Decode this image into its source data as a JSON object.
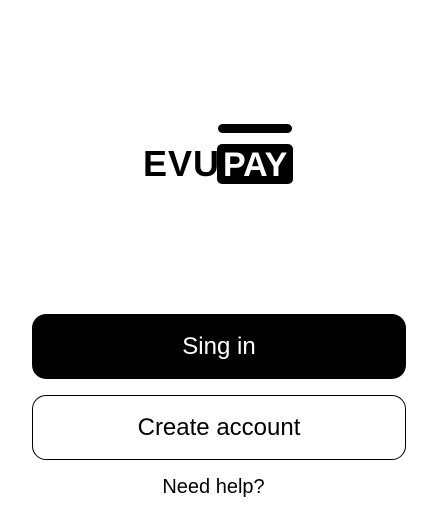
{
  "logo": {
    "name": "EVUPAY",
    "prefix": "EVU",
    "highlight": "PAY"
  },
  "actions": {
    "sign_in_label": "Sing in",
    "create_account_label": "Create account",
    "help_label": "Need help?"
  },
  "colors": {
    "primary": "#000000",
    "background": "#ffffff",
    "primary_text": "#ffffff"
  }
}
